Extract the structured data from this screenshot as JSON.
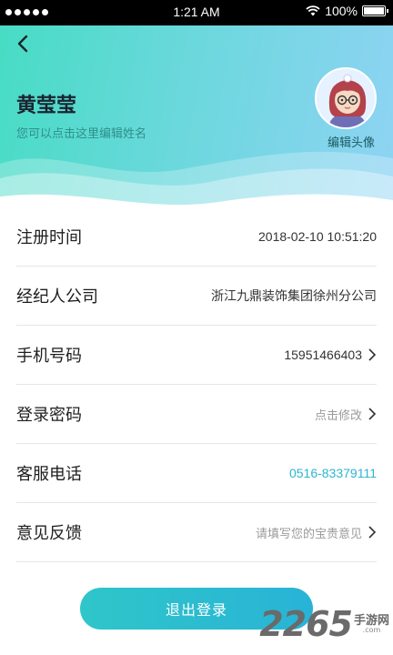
{
  "status_bar": {
    "time": "1:21 AM",
    "battery": "100%"
  },
  "profile": {
    "name": "黄莹莹",
    "edit_name_hint": "您可以点击这里编辑姓名",
    "edit_avatar_label": "编辑头像"
  },
  "rows": [
    {
      "label": "注册时间",
      "value": "2018-02-10 10:51:20"
    },
    {
      "label": "经纪人公司",
      "value": "浙江九鼎装饰集团徐州分公司"
    },
    {
      "label": "手机号码",
      "value": "15951466403"
    },
    {
      "label": "登录密码",
      "value": "点击修改"
    },
    {
      "label": "客服电话",
      "value": "0516-83379111"
    },
    {
      "label": "意见反馈",
      "value": "请填写您的宝贵意见"
    }
  ],
  "logout_label": "退出登录",
  "watermark": {
    "number": "2265",
    "site": "手游网",
    "domain": ".com"
  },
  "colors": {
    "accent": "#2bb5d1",
    "header_start": "#47dcc4",
    "header_end": "#8fd3f4",
    "button": "#2fc6c9"
  }
}
